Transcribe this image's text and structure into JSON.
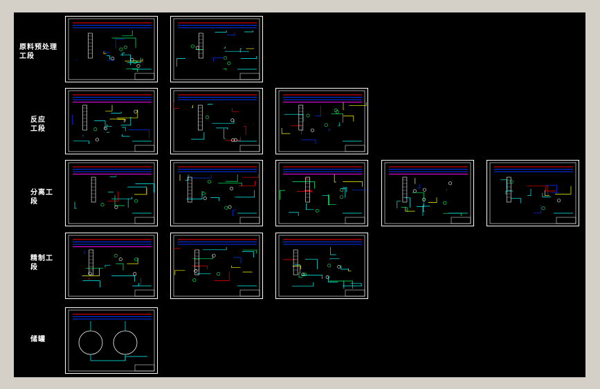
{
  "colors": {
    "background": "#000000",
    "frame": "#ffffff",
    "pipe_cyan": "#00ffff",
    "pipe_blue": "#0033ff",
    "pipe_red": "#ff0000",
    "pipe_yellow": "#ffff00",
    "pipe_green": "#00ff66",
    "pipe_magenta": "#ff00ff"
  },
  "rows": [
    {
      "label": "原料预处理\n工段",
      "sheets": [
        {
          "variant": "pretreat-a"
        },
        {
          "variant": "pretreat-b"
        }
      ]
    },
    {
      "label": "反应\n工段",
      "sheets": [
        {
          "variant": "reaction-a"
        },
        {
          "variant": "reaction-b"
        },
        {
          "variant": "reaction-c"
        }
      ]
    },
    {
      "label": "分离工\n段",
      "sheets": [
        {
          "variant": "separation-a"
        },
        {
          "variant": "separation-b"
        },
        {
          "variant": "separation-c"
        },
        {
          "variant": "separation-d"
        },
        {
          "variant": "separation-e"
        }
      ]
    },
    {
      "label": "精制工\n段",
      "sheets": [
        {
          "variant": "refining-a"
        },
        {
          "variant": "refining-b"
        },
        {
          "variant": "refining-c"
        }
      ]
    },
    {
      "label": "储罐",
      "sheets": [
        {
          "variant": "storage-tanks"
        }
      ]
    }
  ]
}
